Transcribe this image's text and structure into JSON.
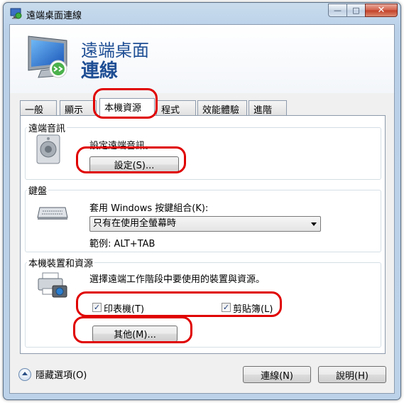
{
  "window": {
    "title": "遠端桌面連線",
    "controls": {
      "minimize": "—",
      "maximize": "□",
      "close": "✕"
    }
  },
  "banner": {
    "line1": "遠端桌面",
    "line2": "連線"
  },
  "tabs": [
    {
      "label": "一般"
    },
    {
      "label": "顯示"
    },
    {
      "label": "本機資源",
      "active": true
    },
    {
      "label": "程式"
    },
    {
      "label": "效能體驗"
    },
    {
      "label": "進階"
    }
  ],
  "audio": {
    "group_label": "遠端音訊",
    "description": "設定遠端音訊。",
    "button": "設定(S)..."
  },
  "keyboard": {
    "group_label": "鍵盤",
    "description": "套用 Windows 按鍵組合(K):",
    "selected": "只有在使用全螢幕時",
    "example": "範例: ALT+TAB"
  },
  "devices": {
    "group_label": "本機裝置和資源",
    "description": "選擇遠端工作階段中要使用的裝置與資源。",
    "printer": {
      "label": "印表機(T)",
      "checked": true
    },
    "clipboard": {
      "label": "剪貼簿(L)",
      "checked": true
    },
    "more_button": "其他(M)..."
  },
  "footer": {
    "hide_options": "隱藏選項(O)",
    "connect": "連線(N)",
    "help": "說明(H)"
  },
  "theme": {
    "accent": "#1e4e94",
    "highlight": "#e00000"
  }
}
